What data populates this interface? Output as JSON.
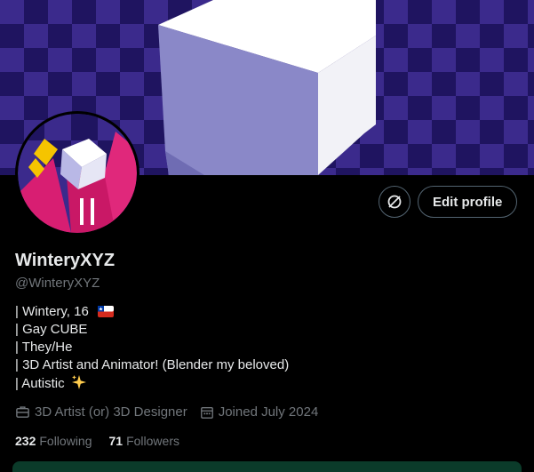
{
  "profile": {
    "name": "WinteryXYZ",
    "handle": "@WinteryXYZ",
    "bio": [
      "| Wintery, 16",
      "| Gay CUBE",
      "| They/He",
      "| 3D Artist and Animator! (Blender my beloved)",
      "| Autistic"
    ],
    "profession": "3D Artist (or) 3D Designer",
    "joined": "Joined July 2024",
    "following_count": "232",
    "following_label": "Following",
    "followers_count": "71",
    "followers_label": "Followers"
  },
  "actions": {
    "edit_profile_label": "Edit profile",
    "circle_button_icon": "slashed-circle-icon"
  },
  "icons": {
    "profession": "briefcase-icon",
    "joined": "calendar-icon",
    "flag": "chile-flag-icon",
    "sparkle": "sparkles-icon"
  },
  "colors": {
    "background": "#000000",
    "text_primary": "#e7e9ea",
    "text_secondary": "#71767b",
    "border": "#536471",
    "banner_purple": "#3b2a8c",
    "avatar_magenta": "#d81e72"
  }
}
